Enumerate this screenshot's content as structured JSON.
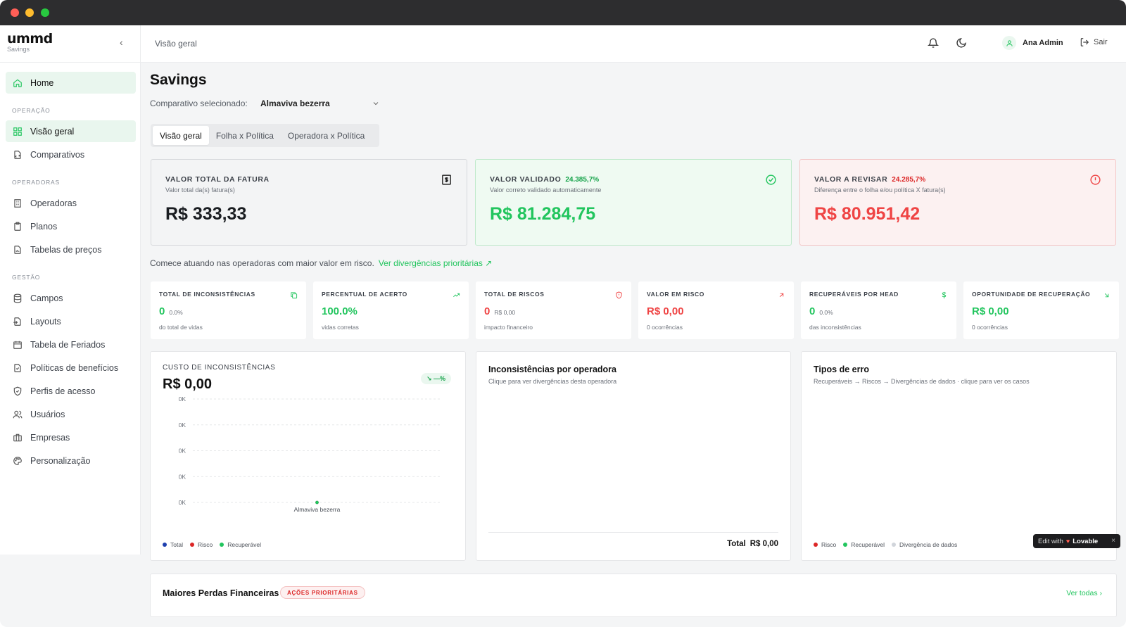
{
  "brand": {
    "logo": "ummd",
    "sub": "Savings"
  },
  "sidebar": {
    "home": "Home",
    "sections": [
      "OPERAÇÃO",
      "OPERADORAS",
      "GESTÃO"
    ],
    "items": [
      "Visão geral",
      "Comparativos",
      "Operadoras",
      "Planos",
      "Tabelas de preços",
      "Campos",
      "Layouts",
      "Tabela de Feriados",
      "Políticas de benefícios",
      "Perfis de acesso",
      "Usuários",
      "Empresas",
      "Personalização"
    ]
  },
  "header": {
    "breadcrumb": "Visão geral",
    "user": "Ana Admin",
    "logout": "Sair"
  },
  "page": {
    "title": "Savings",
    "compare_label": "Comparativo selecionado:",
    "compare_value": "Almaviva bezerra",
    "tabs": [
      "Visão geral",
      "Folha x Política",
      "Operadora x Política"
    ]
  },
  "summary_cards": [
    {
      "title": "VALOR TOTAL DA FATURA",
      "pct": "",
      "subtitle": "Valor total da(s) fatura(s)",
      "value": "R$ 333,33"
    },
    {
      "title": "VALOR VALIDADO",
      "pct": "24.385,7%",
      "subtitle": "Valor correto validado automaticamente",
      "value": "R$ 81.284,75"
    },
    {
      "title": "VALOR A REVISAR",
      "pct": "24.285,7%",
      "subtitle": "Diferença entre o folha e/ou política X fatura(s)",
      "value": "R$ 80.951,42"
    }
  ],
  "hint": {
    "text": "Comece atuando nas operadoras com maior valor em risco.",
    "link": "Ver divergências prioritárias ↗"
  },
  "kpis": [
    {
      "title": "TOTAL DE INCONSISTÊNCIAS",
      "value": "0",
      "small": "0.0%",
      "sub": "do total de vidas"
    },
    {
      "title": "PERCENTUAL DE ACERTO",
      "value": "100.0%",
      "small": "",
      "sub": "vidas corretas"
    },
    {
      "title": "TOTAL DE RISCOS",
      "value": "0",
      "small": "R$ 0,00",
      "sub": "impacto financeiro"
    },
    {
      "title": "VALOR EM RISCO",
      "value": "R$ 0,00",
      "small": "",
      "sub": "0 ocorrências"
    },
    {
      "title": "RECUPERÁVEIS POR HEAD",
      "value": "0",
      "small": "0.0%",
      "sub": "das inconsistências"
    },
    {
      "title": "OPORTUNIDADE DE RECUPERAÇÃO",
      "value": "R$ 0,00",
      "small": "",
      "sub": "0 ocorrências"
    }
  ],
  "cost_panel": {
    "overline": "CUSTO DE INCONSISTÊNCIAS",
    "amount": "R$ 0,00",
    "trend": "↘ —%",
    "legend": [
      "Total",
      "Risco",
      "Recuperável"
    ]
  },
  "chart_data": {
    "type": "line",
    "categories": [
      "Almaviva bezerra"
    ],
    "y_tick_labels": [
      "0K",
      "0K",
      "0K",
      "0K",
      "0K"
    ],
    "series": [
      {
        "name": "Total",
        "values": [
          0
        ],
        "color": "#1e40af"
      },
      {
        "name": "Risco",
        "values": [
          0
        ],
        "color": "#dc2626"
      },
      {
        "name": "Recuperável",
        "values": [
          0
        ],
        "color": "#22c55e"
      }
    ],
    "grid": true,
    "legend_position": "bottom-left"
  },
  "operator_panel": {
    "title": "Inconsistências por operadora",
    "subtitle": "Clique para ver divergências desta operadora",
    "total_label": "Total",
    "total_value": "R$ 0,00"
  },
  "errors_panel": {
    "title": "Tipos de erro",
    "subtitle": "Recuperáveis → Riscos → Divergências de dados · clique para ver os casos",
    "legend": [
      "Risco",
      "Recuperável",
      "Divergência de dados"
    ]
  },
  "lovable": {
    "prefix": "Edit with",
    "brand": "Lovable",
    "close": "×"
  },
  "losses": {
    "title": "Maiores Perdas Financeiras",
    "badge": "AÇÕES PRIORITÁRIAS",
    "link": "Ver todas ›"
  },
  "colors": {
    "accent": "#22c55e",
    "danger": "#ef4444",
    "navy": "#1e40af"
  }
}
